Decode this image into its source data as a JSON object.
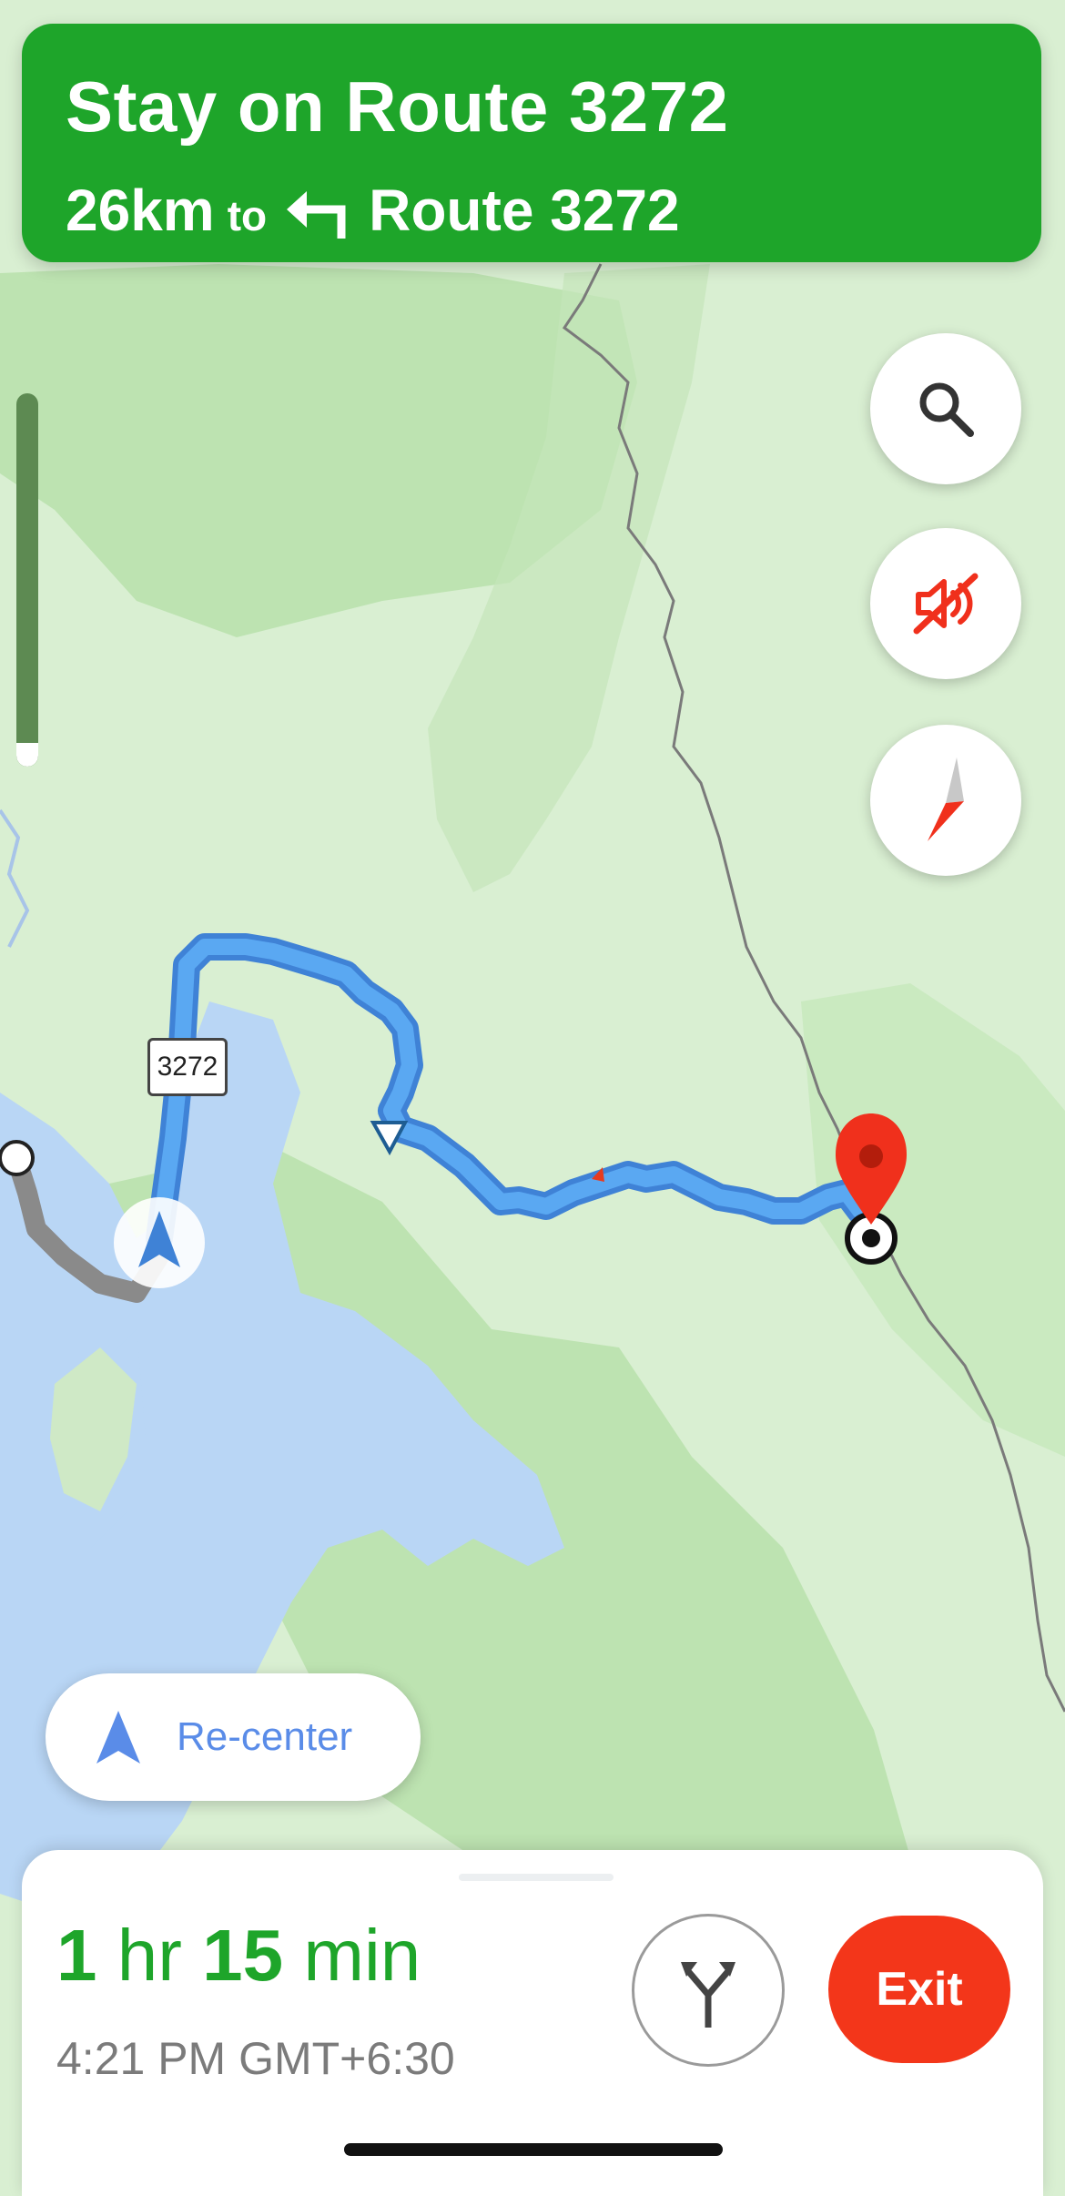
{
  "banner": {
    "instruction": "Stay on Route 3272",
    "distance": "26km",
    "to_word": "to",
    "next_road": "Route 3272",
    "color": "#1ea52a"
  },
  "map": {
    "route_shield": "3272",
    "route_color": "#5aa8f2",
    "traveled_color": "#8a8a8a",
    "water_color": "#b9d6f5",
    "destination_color": "#f0301c"
  },
  "controls": {
    "search_icon": "search-icon",
    "mute_icon": "sound-off-icon",
    "compass_icon": "compass-icon"
  },
  "recenter": {
    "label": "Re-center"
  },
  "trip": {
    "hours": "1",
    "hr_unit": "hr",
    "minutes": "15",
    "min_unit": "min",
    "arrival": "4:21 PM GMT+6:30",
    "alternate_icon": "alternate-routes-icon",
    "exit_label": "Exit"
  }
}
